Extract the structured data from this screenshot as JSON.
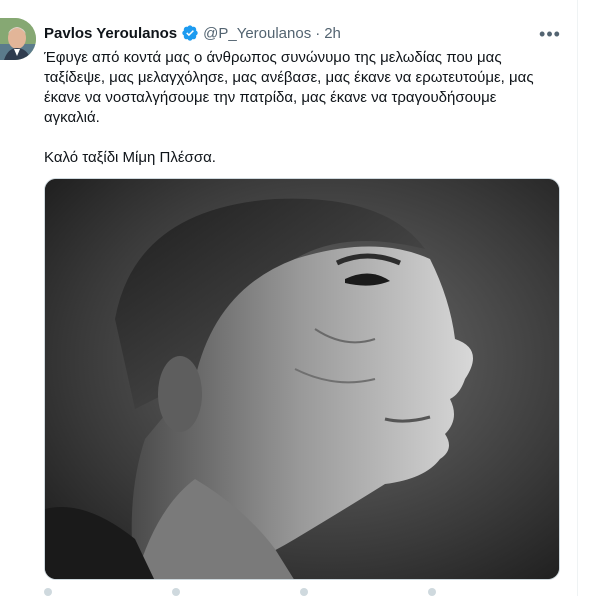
{
  "tweet": {
    "author_name": "Pavlos Yeroulanos",
    "handle": "@P_Yeroulanos",
    "separator": "·",
    "time": "2h",
    "more_label": "•••",
    "text_lines": [
      "Έφυγε από κοντά μας ο άνθρωπος συνώνυμο της μελωδίας που μας",
      "ταξίδεψε, μας μελαγχόλησε, μας ανέβασε, μας έκανε να ερωτευτούμε, μας",
      "έκανε να νοσταλγήσουμε την πατρίδα, μας έκανε να τραγουδήσουμε",
      "αγκαλιά."
    ],
    "closing_line": "Καλό ταξίδι Μίμη Πλέσσα.",
    "verified_color": "#1d9bf0",
    "icons": {
      "verified": "verified-badge-icon",
      "more": "more-options-icon"
    }
  }
}
